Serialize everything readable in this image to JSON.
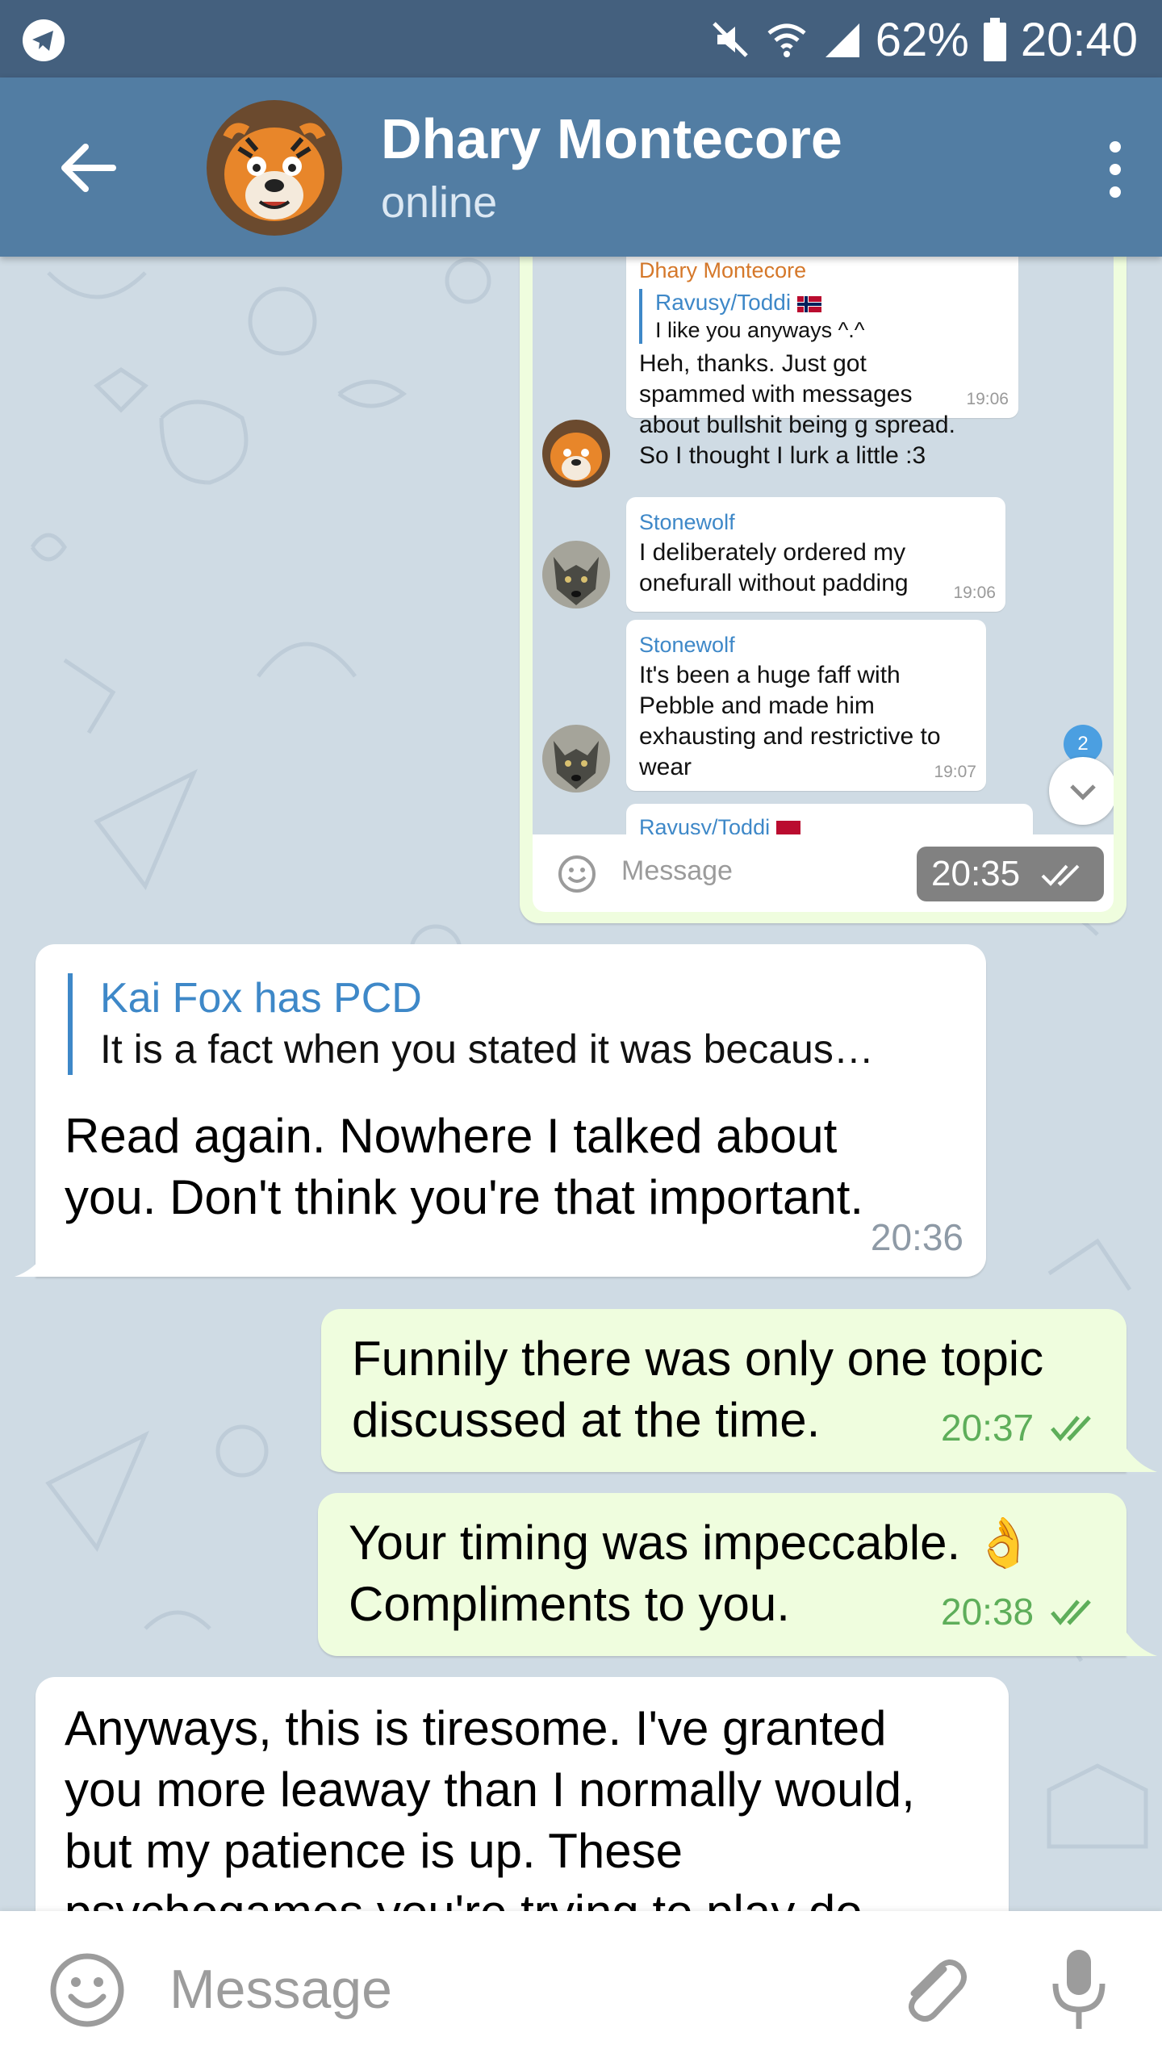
{
  "status_bar": {
    "battery": "62%",
    "time": "20:40",
    "icons": [
      "telegram-icon",
      "mute-icon",
      "wifi-icon",
      "signal-icon",
      "battery-icon"
    ]
  },
  "header": {
    "title": "Dhary Montecore",
    "status": "online",
    "icons": [
      "back-arrow-icon",
      "more-vert-icon"
    ]
  },
  "screenshot_message": {
    "messages": [
      {
        "sender": "Dhary Montecore",
        "quote_sender": "Ravusy/Toddi",
        "quote_text": "I like you anyways ^.^",
        "text_lines": [
          "Heh, thanks. Just got",
          "spammed with messages",
          "about bullshit being g spread.",
          "So I thought I lurk a little :3"
        ],
        "time": "19:06"
      },
      {
        "sender": "Stonewolf",
        "text_lines": [
          "I deliberately ordered my",
          "onefurall without padding"
        ],
        "time": "19:06"
      },
      {
        "sender": "Stonewolf",
        "text_lines": [
          "It's been a huge faff with",
          "Pebble and made him",
          "exhausting and restrictive to",
          "wear"
        ],
        "time": "19:07"
      },
      {
        "sender": "Ravusy/Toddi"
      }
    ],
    "unread_count": "2",
    "input_placeholder": "Message",
    "time": "20:35"
  },
  "messages": [
    {
      "direction": "in",
      "reply_to_name": "Kai Fox has PCD",
      "reply_to_text": "It is a fact when you stated it was becaus…",
      "text_lines": [
        "Read again. Nowhere I talked about",
        "you. Don't think you're that important."
      ],
      "time": "20:36"
    },
    {
      "direction": "out",
      "text_lines": [
        "Funnily there was only one topic",
        "discussed at the time."
      ],
      "time": "20:37"
    },
    {
      "direction": "out",
      "text_lines": [
        "Your timing was impeccable. 👌",
        "Compliments to you."
      ],
      "time": "20:38"
    },
    {
      "direction": "in",
      "text_lines": [
        "Anyways, this is tiresome. I've granted",
        "you more leaway than I normally would,",
        "but my patience is up. These",
        "psychogames you're trying to play do"
      ]
    }
  ],
  "input_bar": {
    "placeholder": "Message",
    "icons": [
      "emoji-icon",
      "attach-icon",
      "microphone-icon"
    ]
  }
}
